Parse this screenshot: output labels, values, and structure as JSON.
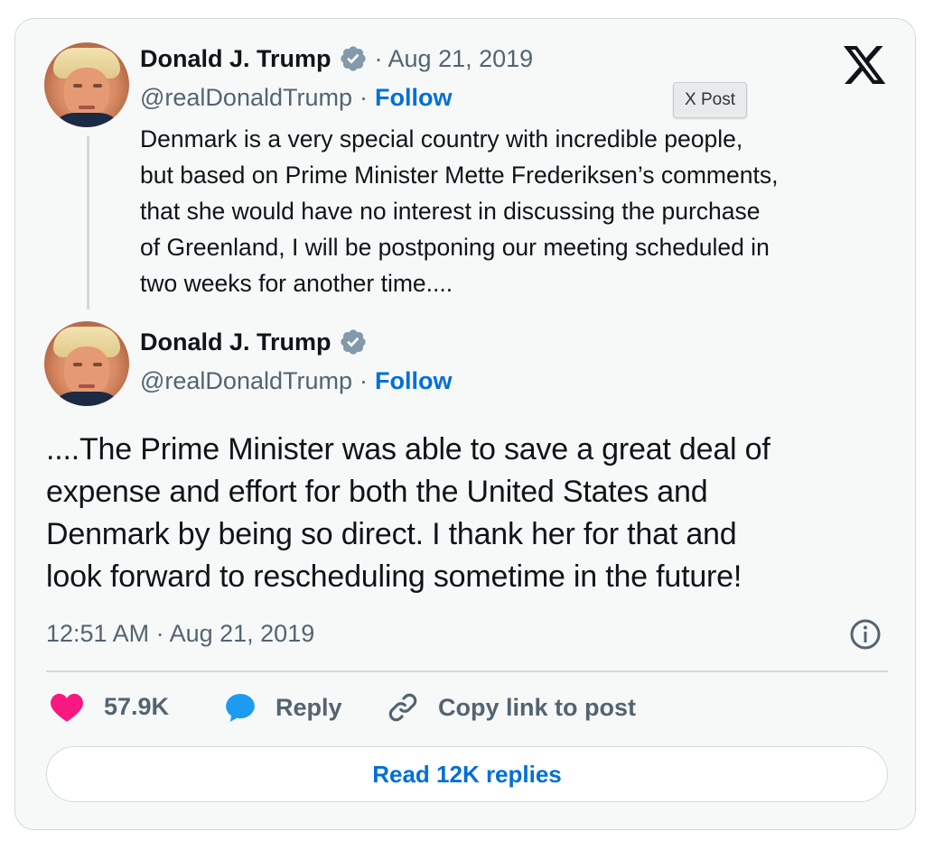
{
  "embed": {
    "logo_icon": "x-logo-icon",
    "tooltip": "X Post",
    "colors": {
      "follow": "#006fd6",
      "muted": "#536471",
      "verified": "#829aab",
      "like": "#f91880",
      "reply": "#1d9bf0",
      "border": "#cfd9de"
    }
  },
  "quoted_tweet": {
    "author_name": "Donald J. Trump",
    "separator_date": "· Aug 21, 2019",
    "handle": "@realDonaldTrump",
    "dot": "·",
    "follow_label": "Follow",
    "text_lines": [
      "Denmark is a very special country with incredible people,",
      "but based on Prime Minister Mette Frederiksen’s comments,",
      "that she would have no interest in discussing the purchase",
      "of Greenland, I will be postponing our meeting scheduled in",
      "two weeks for another time...."
    ]
  },
  "main_tweet": {
    "author_name": "Donald J. Trump",
    "handle": "@realDonaldTrump",
    "dot": "·",
    "follow_label": "Follow",
    "text_lines": [
      "....The Prime Minister was able to save a great deal of",
      "expense and effort for both the United States and",
      "Denmark by being so direct. I thank her for that and",
      "look forward to rescheduling sometime in the future!"
    ],
    "timestamp": "12:51 AM · Aug 21, 2019"
  },
  "actions": {
    "like_count": "57.9K",
    "reply_label": "Reply",
    "copy_label": "Copy link to post",
    "read_replies_label": "Read 12K replies"
  }
}
